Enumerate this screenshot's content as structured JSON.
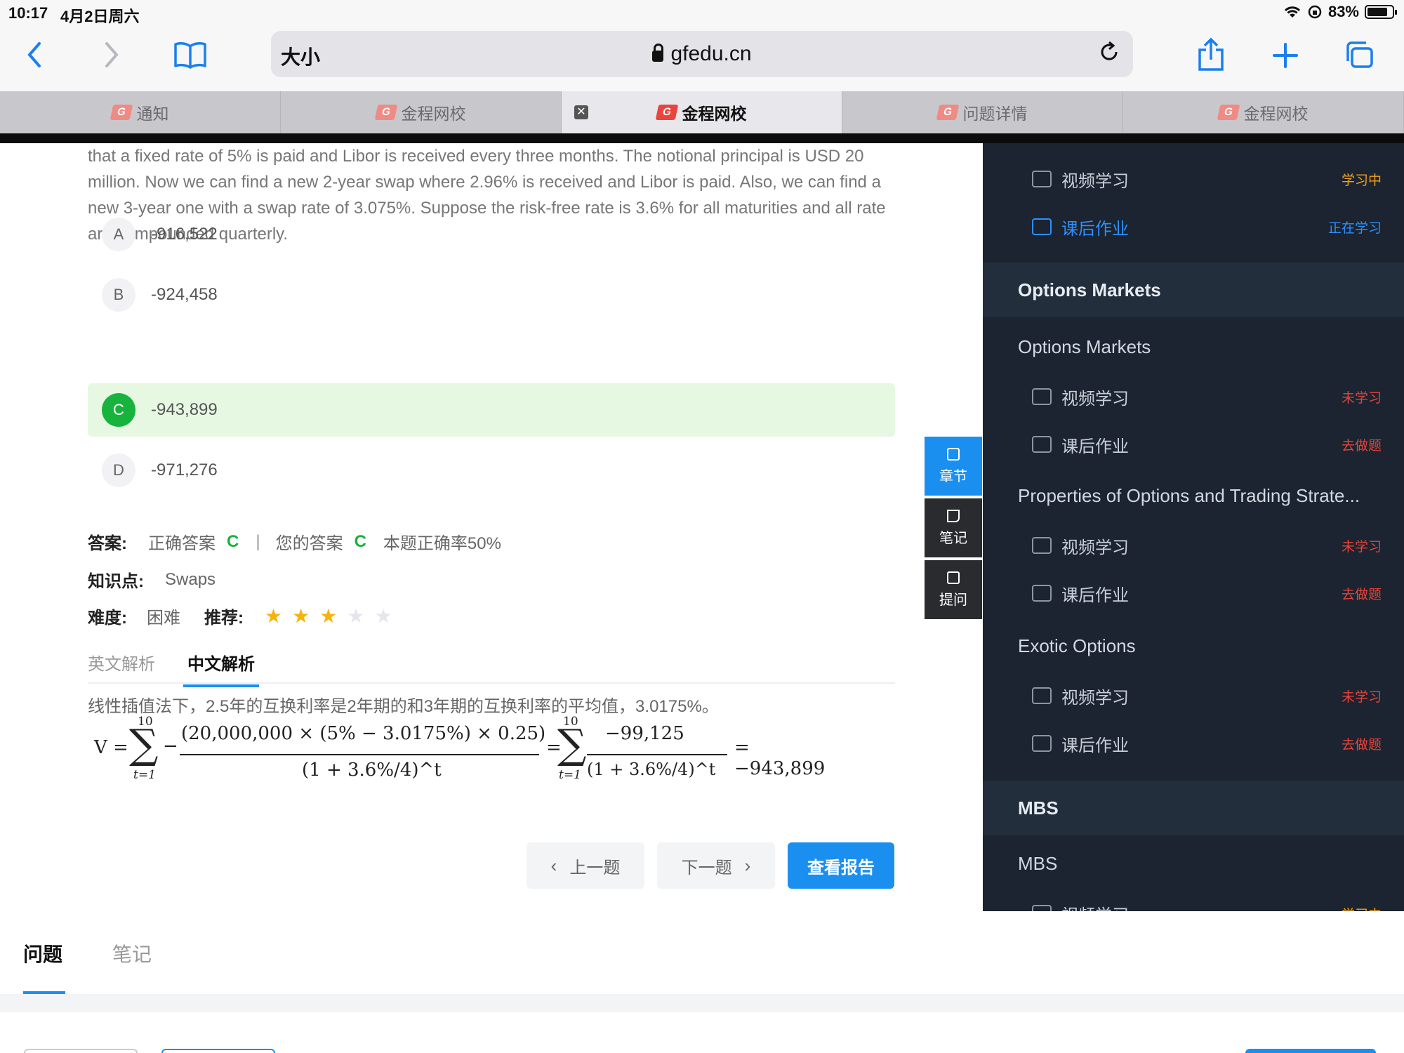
{
  "status_bar": {
    "time": "10:17",
    "date": "4月2日周六",
    "battery": "83%",
    "battery_level": 0.83
  },
  "toolbar": {
    "text_size_label": "大小",
    "url": "gfedu.cn"
  },
  "tabs": [
    {
      "label": "通知",
      "active": false
    },
    {
      "label": "金程网校",
      "active": false
    },
    {
      "label": "金程网校",
      "active": true
    },
    {
      "label": "问题详情",
      "active": false
    },
    {
      "label": "金程网校",
      "active": false
    }
  ],
  "question": {
    "text": "that a fixed rate of 5% is paid and Libor is received every three months. The notional principal is USD 20 million. Now we can find a new 2-year swap where 2.96% is received and Libor is paid. Also, we can find a new 3-year one with a swap rate of 3.075%. Suppose the risk-free rate is 3.6% for all maturities and all rate are compounded quarterly.",
    "options": [
      {
        "letter": "A",
        "value": "-916,522",
        "correct": false
      },
      {
        "letter": "B",
        "value": "-924,458",
        "correct": false
      },
      {
        "letter": "C",
        "value": "-943,899",
        "correct": true
      },
      {
        "letter": "D",
        "value": "-971,276",
        "correct": false
      }
    ]
  },
  "answer": {
    "label": "答案:",
    "correct_label": "正确答案",
    "correct_value": "C",
    "separator": "|",
    "yours_label": "您的答案",
    "yours_value": "C",
    "rate_text": "本题正确率50%"
  },
  "knowledge": {
    "label": "知识点:",
    "value": "Swaps"
  },
  "difficulty": {
    "label": "难度:",
    "value": "困难",
    "recommend_label": "推荐:",
    "stars": 3,
    "max_stars": 5
  },
  "analysis_tabs": [
    {
      "label": "英文解析",
      "active": false
    },
    {
      "label": "中文解析",
      "active": true
    }
  ],
  "analysis": {
    "text": "线性插值法下，2.5年的互换利率是2年期的和3年期的互换利率的平均值，3.0175%。",
    "formula": {
      "lhs": "V =",
      "sum_upper": "10",
      "sum_lower": "t=1",
      "num1": "(20,000,000 × (5% − 3.0175%) × 0.25)",
      "den": "(1 + 3.6%/4)^t",
      "eq": "=",
      "num2": "−99,125",
      "result": "= −943,899"
    }
  },
  "nav": {
    "prev": "上一题",
    "next": "下一题",
    "report": "查看报告"
  },
  "side_buttons": [
    {
      "label": "章节"
    },
    {
      "label": "笔记"
    },
    {
      "label": "提问"
    }
  ],
  "panel": {
    "top_items": [
      {
        "label": "视频学习",
        "status": "学习中",
        "status_color": "#f0a020",
        "active": false
      },
      {
        "label": "课后作业",
        "status": "正在学习",
        "status_color": "#2e90ff",
        "active": true
      }
    ],
    "sections": [
      {
        "title": "Options Markets",
        "chapters": [
          {
            "title": "Options Markets",
            "items": [
              {
                "label": "视频学习",
                "status": "未学习"
              },
              {
                "label": "课后作业",
                "status": "去做题"
              }
            ]
          },
          {
            "title": "Properties of Options and Trading Strate...",
            "items": [
              {
                "label": "视频学习",
                "status": "未学习"
              },
              {
                "label": "课后作业",
                "status": "去做题"
              }
            ]
          },
          {
            "title": "Exotic Options",
            "items": [
              {
                "label": "视频学习",
                "status": "未学习"
              },
              {
                "label": "课后作业",
                "status": "去做题"
              }
            ]
          }
        ]
      },
      {
        "title": "MBS",
        "chapters": [
          {
            "title": "MBS",
            "items": [
              {
                "label": "视频学习",
                "status": "学习中"
              }
            ]
          }
        ]
      }
    ]
  },
  "bottom_tabs": [
    {
      "label": "问题",
      "active": true
    },
    {
      "label": "笔记",
      "active": false
    }
  ]
}
